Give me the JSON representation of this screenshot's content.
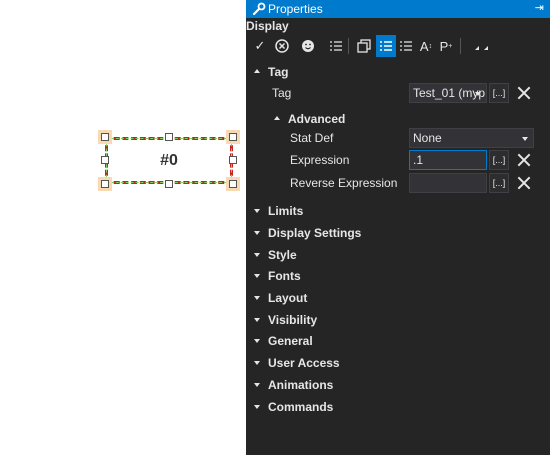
{
  "canvas": {
    "widget_text": "#0"
  },
  "panel": {
    "title": "Properties",
    "section": "Display",
    "toolbar": {
      "icons": [
        "check-icon",
        "cancel-circle-icon",
        "smiley-icon",
        "list-icon",
        "copy-icon",
        "categorized-list-icon",
        "alphabetical-list-icon",
        "font-a-icon",
        "font-p-icon",
        "more-icon"
      ],
      "active": "categorized-list-icon",
      "font_a_label": "A",
      "font_p_label": "P"
    },
    "tag_group": {
      "label": "Tag",
      "tag_label": "Tag",
      "tag_value": "Test_01 (myp",
      "advanced": {
        "label": "Advanced",
        "stat_def_label": "Stat Def",
        "stat_def_value": "None",
        "expression_label": "Expression",
        "expression_value": ".1",
        "reverse_expression_label": "Reverse Expression",
        "reverse_expression_value": ""
      },
      "ellipsis_label": "[...]"
    },
    "groups": [
      "Limits",
      "Display Settings",
      "Style",
      "Fonts",
      "Layout",
      "Visibility",
      "General",
      "User Access",
      "Animations",
      "Commands"
    ]
  }
}
